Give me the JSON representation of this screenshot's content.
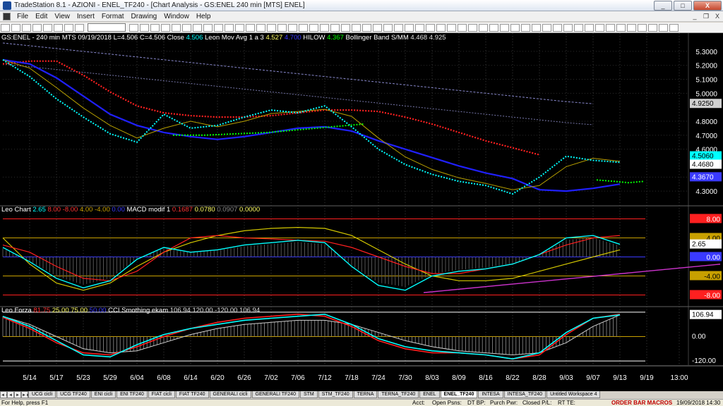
{
  "window": {
    "title": "TradeStation 8.1 - AZIONI - ENEL_TF240 - [Chart Analysis - GS:ENEL  240 min  [MTS] ENEL]",
    "controls": [
      "_",
      "□",
      "X"
    ]
  },
  "menu": {
    "items": [
      "File",
      "Edit",
      "View",
      "Insert",
      "Format",
      "Drawing",
      "Window",
      "Help"
    ],
    "mdi_controls": [
      "_",
      "❐",
      "X"
    ]
  },
  "panel1": {
    "header": [
      {
        "text": "GS:ENEL - 240 min   MTS  09/19/2018  L=4.506  C=4.506  Close",
        "color": "#ffffff"
      },
      {
        "text": "4.506",
        "color": "#00ffff"
      },
      {
        "text": "Leon Mov Avg 1 a 3",
        "color": "#ffffff"
      },
      {
        "text": "4.527",
        "color": "#ffff66"
      },
      {
        "text": "4.700",
        "color": "#3a3aff"
      },
      {
        "text": "HILOW",
        "color": "#ffffff"
      },
      {
        "text": "4.367",
        "color": "#00ff00"
      },
      {
        "text": "Bollinger Band S/MM",
        "color": "#ffffff"
      },
      {
        "text": "4.468",
        "color": "#e0e0e0"
      },
      {
        "text": "4.925",
        "color": "#e0e0e0"
      }
    ],
    "price_labels": [
      "5.3000",
      "5.2000",
      "5.1000",
      "5.0000",
      "4.8000",
      "4.7000",
      "4.6000",
      "4.4000",
      "4.3000"
    ],
    "tags": {
      "t1": "4.9250",
      "t2": "4.5060",
      "t3": "4.4680",
      "t4": "4.3670"
    }
  },
  "panel2": {
    "header": [
      {
        "text": "Leo Chart",
        "color": "#ffffff"
      },
      {
        "text": "2.65",
        "color": "#00ffff"
      },
      {
        "text": "8.00",
        "color": "#ff3333"
      },
      {
        "text": "-8.00",
        "color": "#ff3333"
      },
      {
        "text": "4.00",
        "color": "#c8a000"
      },
      {
        "text": "-4.00",
        "color": "#c8a000"
      },
      {
        "text": "0.00",
        "color": "#3a3aff"
      },
      {
        "text": "MACD modif 1",
        "color": "#ffffff"
      },
      {
        "text": "0.1687",
        "color": "#ff3333"
      },
      {
        "text": "0.0780",
        "color": "#ffff66"
      },
      {
        "text": "0.0907",
        "color": "#888888"
      },
      {
        "text": "0.0000",
        "color": "#ffff66"
      }
    ],
    "tags": {
      "p8": "8.00",
      "p4": "4.00",
      "cur": "2.65",
      "zero": "0.00",
      "m4": "-4.00",
      "m8": "-8.00"
    }
  },
  "panel3": {
    "header": [
      {
        "text": "Leo Forza",
        "color": "#ffffff"
      },
      {
        "text": "81.75",
        "color": "#ff3333"
      },
      {
        "text": "25.00",
        "color": "#ffff66"
      },
      {
        "text": "75.00",
        "color": "#ffff66"
      },
      {
        "text": "50.00",
        "color": "#3a3aff"
      },
      {
        "text": "CCI Smothing ekam",
        "color": "#ffffff"
      },
      {
        "text": "106.94",
        "color": "#e0e0e0"
      },
      {
        "text": "120.00",
        "color": "#e0e0e0"
      },
      {
        "text": "-120.00",
        "color": "#e0e0e0"
      },
      {
        "text": "106.94",
        "color": "#e0e0e0"
      }
    ],
    "tags": {
      "cur": "106.94",
      "zero": "0.00",
      "m120": "-120.00"
    }
  },
  "time_axis": [
    "5/14",
    "5/17",
    "5/23",
    "5/29",
    "6/04",
    "6/08",
    "6/14",
    "6/20",
    "6/26",
    "7/02",
    "7/06",
    "7/12",
    "7/18",
    "7/24",
    "7/30",
    "8/03",
    "8/09",
    "8/16",
    "8/22",
    "8/28",
    "9/03",
    "9/07",
    "9/13",
    "9/19",
    "13:00"
  ],
  "tabs": [
    "UCG cicli",
    "UCG TF240",
    "ENI cicli",
    "ENI TF240",
    "FIAT cicli",
    "FIAT TF240",
    "GENERALI cicli",
    "GENERALI TF240",
    "STM",
    "STM_TF240",
    "TERNA",
    "TERNA_TF240",
    "ENEL",
    "ENEL_TF240",
    "INTESA",
    "INTESA_TF240",
    "Untitled Workspace  4"
  ],
  "active_tab": "ENEL_TF240",
  "status": {
    "help": "For Help, press F1",
    "acct": "Acct:",
    "open_psns": "Open Psns:",
    "dt_bp": "DT BP:",
    "purch_pwr": "Purch Pwr:",
    "closed_pl": "Closed P/L:",
    "rt_te": "RT TE:",
    "order_bar": "ORDER BAR  MACROS",
    "datetime": "19/09/2018 14:30"
  },
  "chart_data": [
    {
      "type": "line",
      "title": "GS:ENEL - 240 min",
      "ylim": [
        4.22,
        5.38
      ],
      "x_dates": [
        "5/14",
        "5/17",
        "5/23",
        "5/29",
        "6/04",
        "6/08",
        "6/14",
        "6/20",
        "6/26",
        "7/02",
        "7/06",
        "7/12",
        "7/18",
        "7/24",
        "7/30",
        "8/03",
        "8/09",
        "8/16",
        "8/22",
        "8/28",
        "9/03",
        "9/07",
        "9/13",
        "9/19"
      ],
      "series": [
        {
          "name": "Close",
          "color": "#00ffff",
          "style": "dotted",
          "values": [
            5.24,
            5.12,
            4.96,
            4.83,
            4.71,
            4.65,
            4.85,
            4.75,
            4.77,
            4.83,
            4.88,
            4.86,
            4.91,
            4.76,
            4.6,
            4.49,
            4.42,
            4.37,
            4.34,
            4.28,
            4.4,
            4.55,
            4.52,
            4.506
          ]
        },
        {
          "values": [
            5.24,
            5.21,
            5.11,
            4.98,
            4.85,
            4.77,
            4.72,
            4.69,
            4.67,
            4.69,
            4.72,
            4.75,
            4.76,
            4.73,
            4.66,
            4.6,
            4.54,
            4.48,
            4.43,
            4.39,
            4.31,
            4.3,
            4.32,
            4.35
          ],
          "color": "#2020ff"
        },
        {
          "values": [
            5.21,
            5.23,
            5.23,
            5.13,
            5.01,
            4.91,
            4.86,
            4.84,
            4.83,
            4.83,
            4.84,
            4.86,
            4.88,
            4.88,
            4.87,
            4.83,
            4.78,
            4.72,
            4.66,
            4.61,
            4.56
          ],
          "color": "#ff2020"
        },
        {
          "values": [
            5.36,
            5.34,
            5.32,
            5.3,
            5.28,
            5.26,
            5.24,
            5.22,
            5.2,
            5.18,
            5.16,
            5.14,
            5.12,
            5.1,
            5.08,
            5.06,
            5.04,
            5.02,
            5.0,
            4.98,
            4.96,
            4.94,
            4.925
          ],
          "color": "#8888cc"
        }
      ]
    },
    {
      "type": "line",
      "title": "Leo Chart",
      "ylim": [
        -10,
        10
      ],
      "series": [
        {
          "values": [
            2.0,
            -1.0,
            -4.5,
            -6.5,
            -5.0,
            -0.5,
            2.0,
            1.0,
            1.5,
            2.5,
            3.0,
            3.5,
            3.0,
            -2.0,
            -6.0,
            -7.0,
            -4.0,
            -3.0,
            -2.5,
            -1.5,
            0.5,
            4.0,
            4.5,
            2.65
          ],
          "color": "#00ffff"
        },
        {
          "values": [
            2.5,
            1.0,
            -2.0,
            -4.5,
            -5.0,
            -3.0,
            1.0,
            4.0,
            4.5,
            4.0,
            3.8,
            3.5,
            3.3,
            2.0,
            0.0,
            -2.0,
            -3.5,
            -3.5,
            -2.5,
            -1.5,
            0.5,
            2.5,
            4.0,
            4.5
          ],
          "color": "#ff2020"
        },
        {
          "values": [
            4.0,
            -1.5,
            -5.5,
            -7.0,
            -5.5,
            -2.0,
            1.0,
            3.0,
            4.5,
            5.5,
            6.0,
            6.2,
            6.0,
            4.5,
            1.5,
            -1.5,
            -4.0,
            -5.0,
            -5.0,
            -4.5,
            -3.0,
            -1.5,
            0.0,
            1.5
          ],
          "color": "#d4c800"
        },
        {
          "values": [
            -7.5,
            -7.0,
            -6.5,
            -6.0,
            -5.5,
            -5.0,
            -4.5,
            -4.0,
            -3.5,
            -3.0,
            -2.5,
            -2.0,
            -1.5
          ],
          "color": "#cc33cc"
        }
      ]
    },
    {
      "type": "line",
      "title": "Leo Forza",
      "ylim": [
        -130,
        130
      ],
      "series": [
        {
          "values": [
            100,
            50,
            -20,
            -90,
            -100,
            -40,
            10,
            40,
            60,
            80,
            90,
            100,
            110,
            60,
            -10,
            -50,
            -70,
            -80,
            -90,
            -110,
            -80,
            20,
            90,
            106.94
          ],
          "color": "#00ffff"
        },
        {
          "values": [
            95,
            40,
            -30,
            -80,
            -90,
            -50,
            0,
            40,
            70,
            90,
            100,
            110,
            100,
            50,
            -20,
            -60,
            -80,
            -80,
            -90,
            -110,
            -90,
            10,
            90,
            110
          ],
          "color": "#ff2020"
        },
        {
          "values": [
            100,
            60,
            0,
            -60,
            -80,
            -70,
            -30,
            10,
            40,
            60,
            70,
            80,
            80,
            60,
            20,
            -20,
            -50,
            -70,
            -80,
            -90,
            -80,
            -30,
            50,
            106.94
          ],
          "color": "#a0a0a0"
        }
      ]
    }
  ]
}
